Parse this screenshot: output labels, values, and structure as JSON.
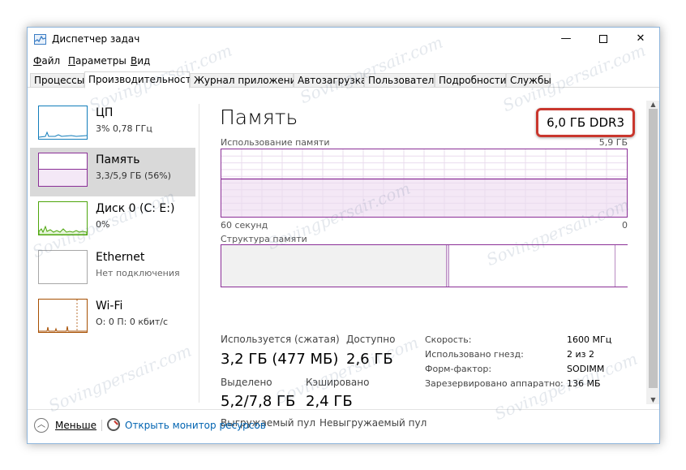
{
  "window": {
    "title": "Диспетчер задач"
  },
  "menu": [
    {
      "text": "Файл",
      "accel": "Ф",
      "rest": "айл"
    },
    {
      "text": "Параметры",
      "accel": "П",
      "rest": "араметры"
    },
    {
      "text": "Вид",
      "accel": "В",
      "rest": "ид"
    }
  ],
  "tabs": [
    "Процессы",
    "Производительность",
    "Журнал приложений",
    "Автозагрузка",
    "Пользователи",
    "Подробности",
    "Службы"
  ],
  "active_tab": "Производительность",
  "sidebar": [
    {
      "name": "ЦП",
      "sub": "3% 0,78 ГГц",
      "color": "#117dbb",
      "selected": false,
      "icon": "cpu-graph-icon"
    },
    {
      "name": "Память",
      "sub": "3,3/5,9 ГБ (56%)",
      "color": "#8b2f97",
      "selected": true,
      "icon": "memory-graph-icon"
    },
    {
      "name": "Диск 0 (C: E:)",
      "sub": "0%",
      "color": "#4da60c",
      "selected": false,
      "icon": "disk-graph-icon"
    },
    {
      "name": "Ethernet",
      "sub": "Нет подключения",
      "color": "#a7a7a7",
      "selected": false,
      "icon": "ethernet-graph-icon"
    },
    {
      "name": "Wi-Fi",
      "sub": "О: 0 П: 0 кбит/с",
      "color": "#a74f01",
      "selected": false,
      "icon": "wifi-graph-icon"
    }
  ],
  "main": {
    "title": "Память",
    "spec": "6,0 ГБ DDR3",
    "usage_label": "Использование памяти",
    "usage_max": "5,9 ГБ",
    "usage_time": "60 секунд",
    "usage_min": "0",
    "usage_fraction": 0.56,
    "structure_label": "Структура памяти",
    "structure": {
      "in_use_fraction": 0.555,
      "modified_fraction": 0.005,
      "standby_fraction": 0.41,
      "free_fraction": 0.03
    },
    "stats": {
      "in_use_label": "Используется (сжатая)",
      "in_use_value": "3,2 ГБ (477 МБ)",
      "available_label": "Доступно",
      "available_value": "2,6 ГБ",
      "committed_label": "Выделено",
      "committed_value": "5,2/7,8 ГБ",
      "cached_label": "Кэшировано",
      "cached_value": "2,4 ГБ",
      "paged_label": "Выгружаемый пул",
      "nonpaged_label": "Невыгружаемый пул"
    },
    "details": [
      {
        "label": "Скорость:",
        "value": "1600 МГц"
      },
      {
        "label": "Использовано гнезд:",
        "value": "2 из 2"
      },
      {
        "label": "Форм-фактор:",
        "value": "SODIMM"
      },
      {
        "label": "Зарезервировано аппаратно:",
        "value": "136 МБ"
      }
    ]
  },
  "footer": {
    "less_label": "Меньше",
    "less_accel": "М",
    "less_rest": "еньше",
    "monitor_link": "Открыть монитор ресурсов"
  },
  "colors": {
    "memory": "#8b2f97",
    "highlight": "#c9372e",
    "link": "#0063b1"
  }
}
